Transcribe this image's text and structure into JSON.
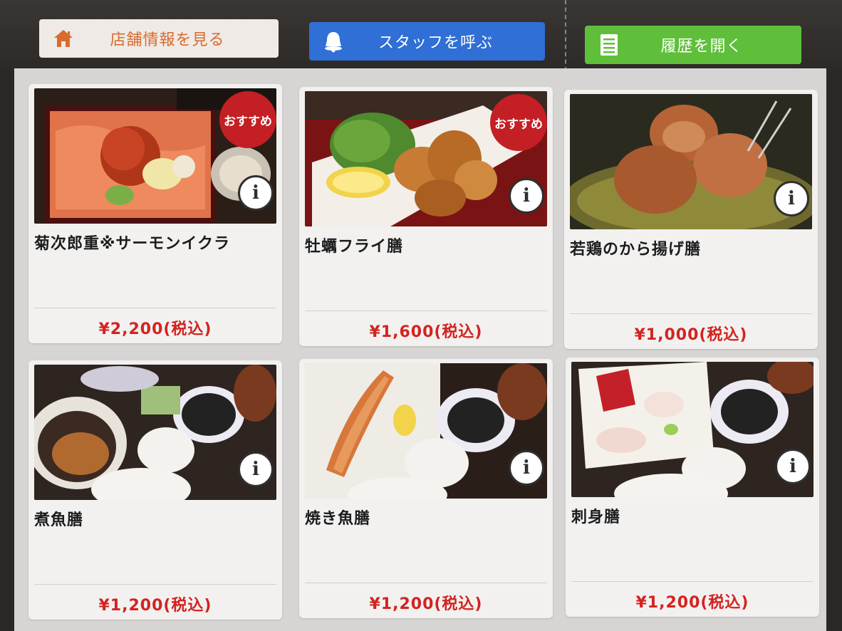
{
  "header": {
    "store_info_label": "店舗情報を見る",
    "call_staff_label": "スタッフを呼ぶ",
    "history_label": "履歴を開く"
  },
  "icons": {
    "store_info": "house-icon",
    "call_staff": "bell-icon",
    "history": "document-list-icon",
    "item_info": "info-icon"
  },
  "colors": {
    "store_info_bg": "#efeae6",
    "store_info_text": "#d86b2e",
    "call_staff_bg": "#2f6fd6",
    "history_bg": "#5fbf3a",
    "price_red": "#d4231f",
    "badge_red": "#c41f24"
  },
  "menu": {
    "items": [
      {
        "name": "菊次郎重※サーモンイクラ",
        "price": "¥2,200(税込)",
        "badge": "おすすめ",
        "info": "i"
      },
      {
        "name": "牡蠣フライ膳",
        "price": "¥1,600(税込)",
        "badge": "おすすめ",
        "info": "i"
      },
      {
        "name": "若鶏のから揚げ膳",
        "price": "¥1,000(税込)",
        "badge": "",
        "info": "i"
      },
      {
        "name": "煮魚膳",
        "price": "¥1,200(税込)",
        "badge": "",
        "info": "i"
      },
      {
        "name": "焼き魚膳",
        "price": "¥1,200(税込)",
        "badge": "",
        "info": "i"
      },
      {
        "name": "刺身膳",
        "price": "¥1,200(税込)",
        "badge": "",
        "info": "i"
      }
    ]
  }
}
